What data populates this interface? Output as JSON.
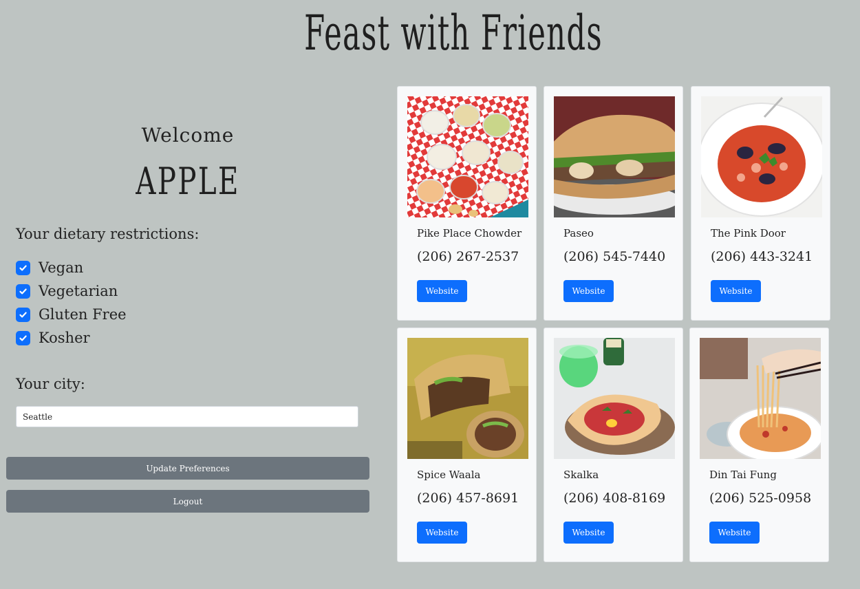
{
  "header": {
    "title": "Feast with Friends"
  },
  "profile": {
    "welcome": "Welcome",
    "username": "APPLE"
  },
  "preferences": {
    "restrictions_heading": "Your dietary restrictions:",
    "restrictions": [
      {
        "label": "Vegan",
        "checked": true
      },
      {
        "label": "Vegetarian",
        "checked": true
      },
      {
        "label": "Gluten Free",
        "checked": true
      },
      {
        "label": "Kosher",
        "checked": true
      }
    ],
    "city_heading": "Your city:",
    "city_value": "Seattle",
    "update_label": "Update Preferences",
    "logout_label": "Logout"
  },
  "restaurants": [
    {
      "name": "Pike Place Chowder",
      "phone": "(206) 267-2537",
      "website_label": "Website"
    },
    {
      "name": "Paseo",
      "phone": "(206) 545-7440",
      "website_label": "Website"
    },
    {
      "name": "The Pink Door",
      "phone": "(206) 443-3241",
      "website_label": "Website"
    },
    {
      "name": "Spice Waala",
      "phone": "(206) 457-8691",
      "website_label": "Website"
    },
    {
      "name": "Skalka",
      "phone": "(206) 408-8169",
      "website_label": "Website"
    },
    {
      "name": "Din Tai Fung",
      "phone": "(206) 525-0958",
      "website_label": "Website"
    }
  ],
  "colors": {
    "background": "#bec4c2",
    "primary": "#0d6efd",
    "secondary": "#6c757d",
    "card": "#f8f9fa"
  }
}
